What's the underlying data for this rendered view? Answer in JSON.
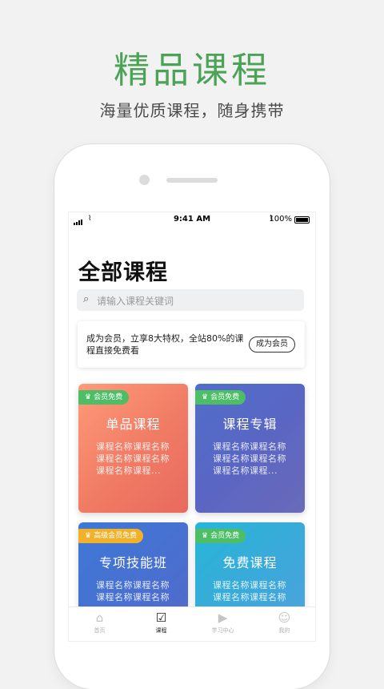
{
  "promo": {
    "title": "精品课程",
    "subtitle": "海量优质课程，随身携带"
  },
  "status_bar": {
    "time": "9:41 AM",
    "battery": "100%"
  },
  "page": {
    "title": "全部课程"
  },
  "search": {
    "placeholder": "请输入课程关键词"
  },
  "member_banner": {
    "text": "成为会员，立享8大特权，全站80%的课程直接免费看",
    "button": "成为会员"
  },
  "cards": [
    {
      "badge": "会员免费",
      "title": "单品课程",
      "desc": "课程名称课程名称课程名称课程名称课程名称课程..."
    },
    {
      "badge": "会员免费",
      "title": "课程专辑",
      "desc": "课程名称课程名称课程名称课程名称课程名称课程..."
    },
    {
      "badge": "高级会员免费",
      "title": "专项技能班",
      "desc": "课程名称课程名称课程名称课程名称"
    },
    {
      "badge": "会员免费",
      "title": "免费课程",
      "desc": "课程名称课程名称课程名称课程名称"
    }
  ],
  "tabbar": [
    {
      "label": "首页",
      "icon": "home-icon"
    },
    {
      "label": "课程",
      "icon": "clipboard-icon"
    },
    {
      "label": "学习中心",
      "icon": "play-icon"
    },
    {
      "label": "我的",
      "icon": "user-icon"
    }
  ],
  "colors": {
    "brand_green": "#4aa356",
    "badge_green": "#4dbd66",
    "badge_orange": "#f2b12a"
  }
}
